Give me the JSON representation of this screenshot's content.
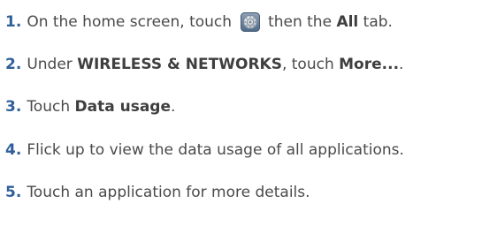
{
  "steps": [
    {
      "number": "1",
      "dot": ".",
      "text_before_icon": "On the home screen, touch",
      "icon": "settings-gear-icon",
      "text_after_icon": "then the",
      "bold": "All",
      "text_end": "tab."
    },
    {
      "number": "2",
      "dot": ".",
      "text_a": "Under",
      "bold_a": "WIRELESS & NETWORKS",
      "text_b": ", touch",
      "bold_b": "More...",
      "text_end": "."
    },
    {
      "number": "3",
      "dot": ".",
      "text_a": "Touch",
      "bold_a": "Data usage",
      "text_end": "."
    },
    {
      "number": "4",
      "dot": ".",
      "text": "Flick up to view the data usage of all applications."
    },
    {
      "number": "5",
      "dot": ".",
      "text": "Touch an application for more details."
    }
  ],
  "colors": {
    "number": "#2f5f99",
    "text": "#4a4a4a",
    "bold_text": "#3f3f3f"
  }
}
